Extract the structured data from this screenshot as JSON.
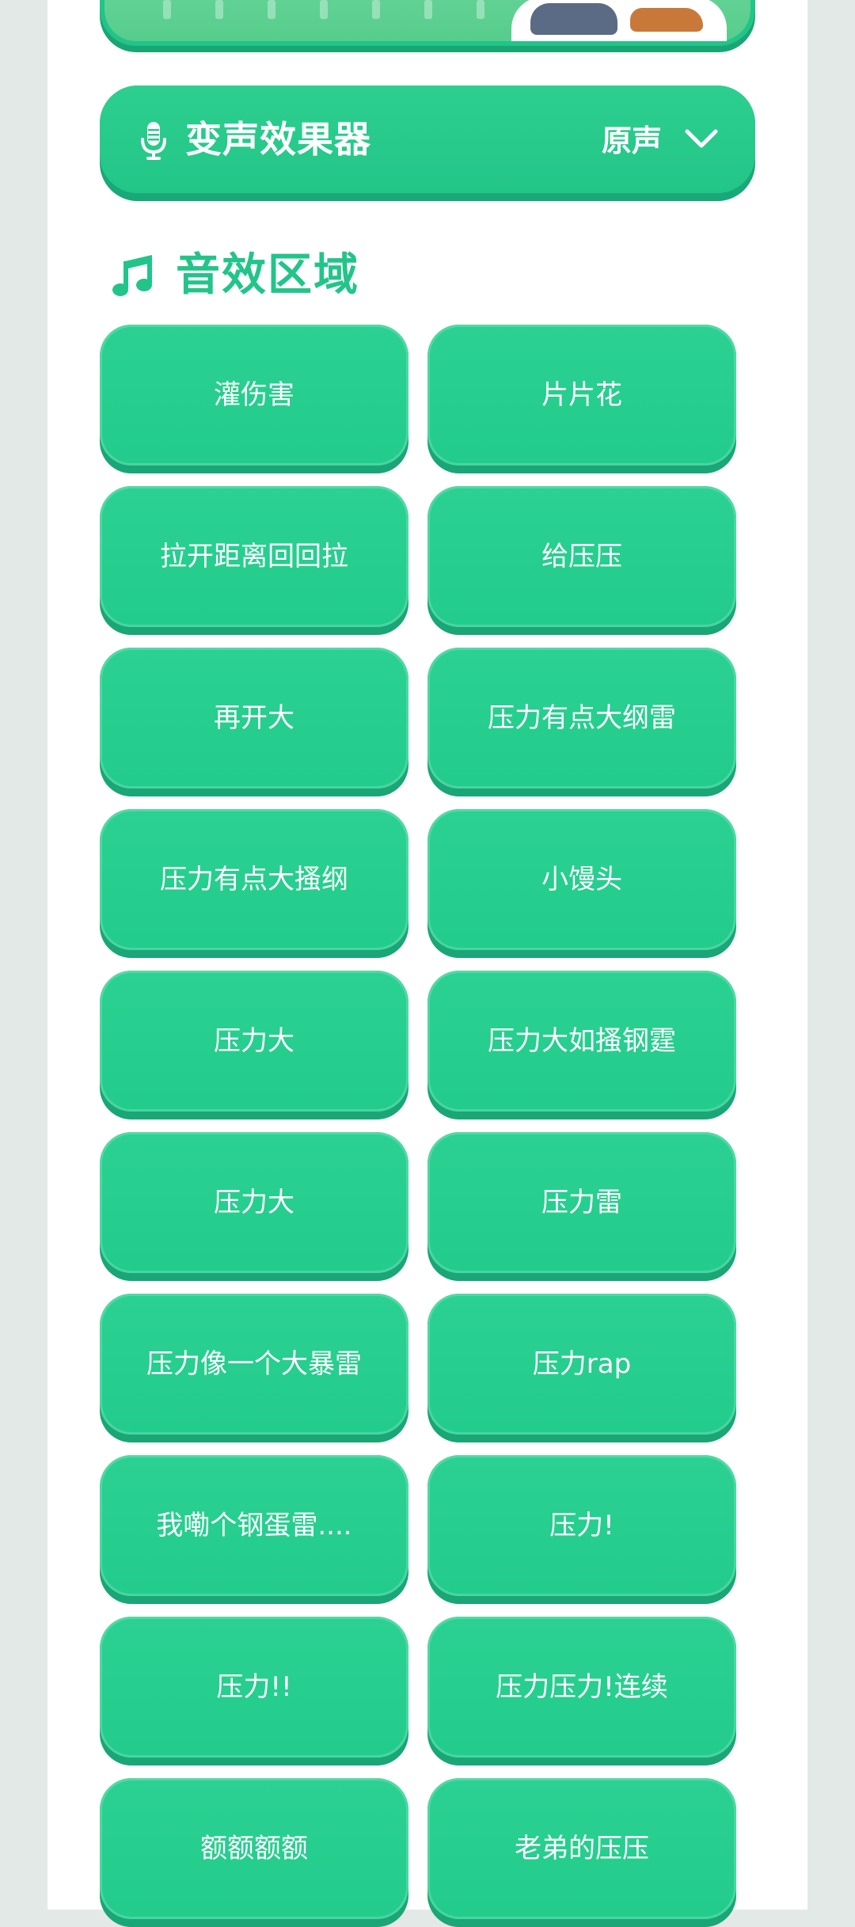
{
  "voice_changer": {
    "title": "变声效果器",
    "selected_value": "原声"
  },
  "section": {
    "title": "音效区域"
  },
  "sounds": [
    "灌伤害",
    "片片花",
    "拉开距离回回拉",
    "给压压",
    "再开大",
    "压力有点大纲雷",
    "压力有点大搔纲",
    "小馒头",
    "压力大",
    "压力大如搔钢霆",
    "压力大",
    "压力雷",
    "压力像一个大暴雷",
    "压力rap",
    "我嘞个钢蛋雷....",
    "压力!",
    "压力!!",
    "压力压力!连续",
    "额额额额",
    "老弟的压压"
  ],
  "colors": {
    "accent": "#22c487",
    "button_shadow": "#1aa676",
    "page_bg": "#e3e9e6",
    "card_bg": "#ffffff"
  },
  "icons": {
    "voice": "microphone-icon",
    "dropdown": "chevron-down-icon",
    "section": "music-note-icon"
  }
}
